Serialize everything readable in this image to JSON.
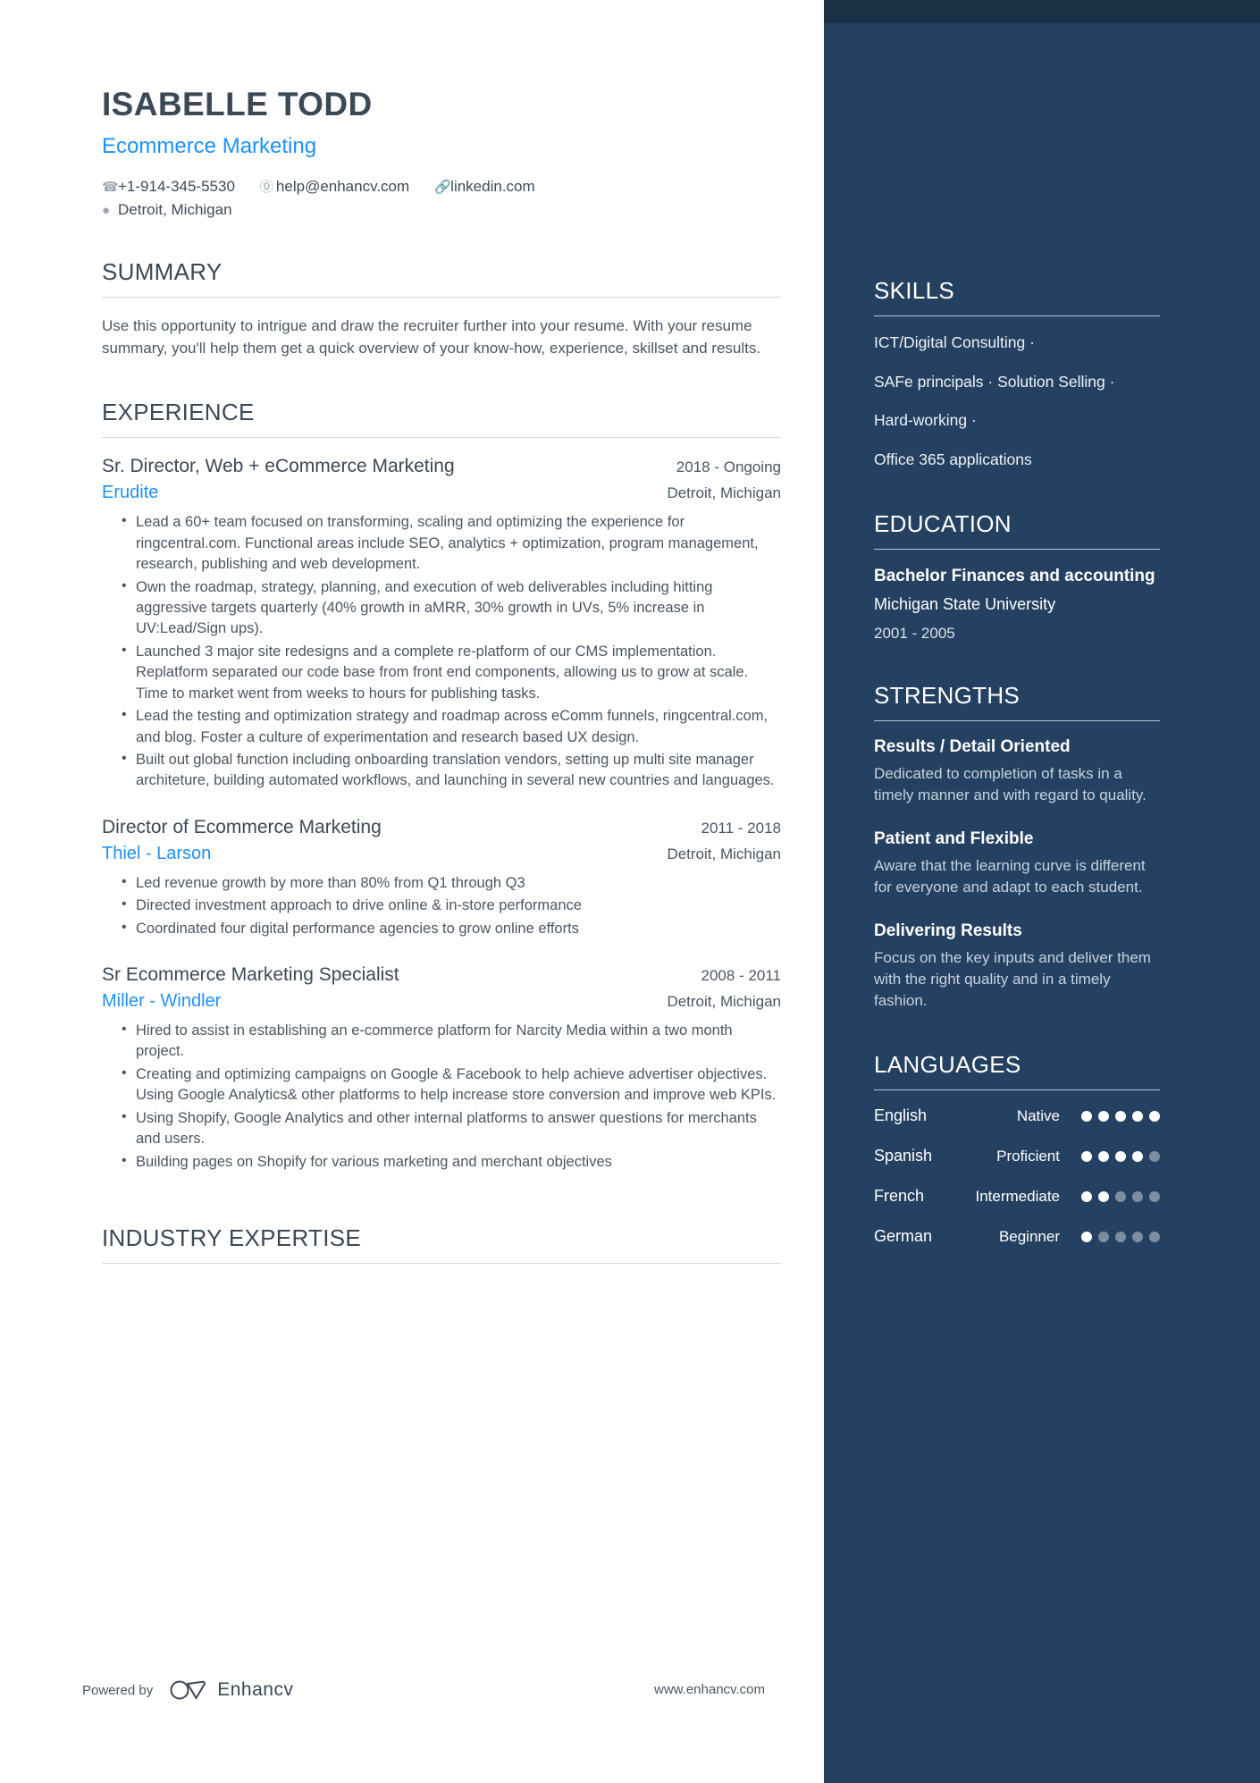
{
  "header": {
    "name": "ISABELLE TODD",
    "role": "Ecommerce Marketing",
    "contacts": {
      "phone": "+1-914-345-5530",
      "email": "help@enhancv.com",
      "linkedin": "linkedin.com",
      "location": "Detroit, Michigan"
    },
    "icons": {
      "phone": "phone-icon",
      "email": "at-sign-icon",
      "link": "link-icon",
      "location": "map-pin-icon"
    }
  },
  "sections": {
    "summary_heading": "SUMMARY",
    "experience_heading": "EXPERIENCE",
    "industry_heading": "INDUSTRY EXPERTISE",
    "skills_heading": "SKILLS",
    "education_heading": "EDUCATION",
    "strengths_heading": "STRENGTHS",
    "languages_heading": "LANGUAGES"
  },
  "summary": "Use this opportunity to intrigue and draw the recruiter further into your resume. With your resume summary, you'll help them get a quick overview of your know-how, experience, skillset and results.",
  "experience": [
    {
      "title": "Sr. Director, Web + eCommerce Marketing",
      "dates": "2018 - Ongoing",
      "company": "Erudite",
      "location": "Detroit, Michigan",
      "bullets": [
        "Lead a 60+ team focused on transforming, scaling and optimizing the experience for ringcentral.com. Functional areas include SEO, analytics + optimization, program management, research, publishing and web development.",
        "Own the roadmap, strategy, planning, and execution of web deliverables including hitting aggressive targets quarterly (40% growth in aMRR, 30% growth in UVs, 5% increase in UV:Lead/Sign ups).",
        "Launched 3 major site redesigns and a complete re-platform of our CMS implementation. Replatform separated our code base from front end components, allowing us to grow at scale. Time to market went from weeks to hours for publishing tasks.",
        "Lead the testing and optimization strategy and roadmap across eComm funnels, ringcentral.com, and blog. Foster a culture of experimentation and research based UX design.",
        "Built out global function including onboarding translation vendors, setting up multi site manager architeture, building automated workflows, and launching in several new countries and languages."
      ]
    },
    {
      "title": "Director of Ecommerce Marketing",
      "dates": "2011 - 2018",
      "company": "Thiel - Larson",
      "location": "Detroit, Michigan",
      "bullets": [
        "Led revenue growth by more than 80% from Q1 through Q3",
        "Directed investment approach to drive online & in-store performance",
        "Coordinated four digital performance agencies to grow online efforts"
      ]
    },
    {
      "title": "Sr Ecommerce Marketing Specialist",
      "dates": "2008 - 2011",
      "company": "Miller - Windler",
      "location": "Detroit, Michigan",
      "bullets": [
        "Hired to assist in establishing an e-commerce platform for Narcity Media within a two month project.",
        " Creating and optimizing campaigns on Google & Facebook to help achieve advertiser objectives. Using Google Analytics& other platforms to help increase store conversion and improve web KPIs.",
        " Using Shopify, Google Analytics and other internal platforms to answer questions for merchants and users.",
        "Building pages on Shopify for various marketing and merchant objectives"
      ]
    }
  ],
  "skills": [
    "ICT/Digital Consulting ·",
    "SAFe principals · Solution Selling ·",
    "Hard-working ·",
    "Office 365 applications"
  ],
  "education": {
    "degree": "Bachelor Finances and accounting",
    "school": "Michigan State University",
    "dates": "2001 - 2005"
  },
  "strengths": [
    {
      "title": "Results / Detail Oriented",
      "description": "Dedicated to completion of tasks in a timely manner and with regard to quality."
    },
    {
      "title": "Patient and Flexible",
      "description": "Aware that the learning curve is different for everyone and adapt to each student."
    },
    {
      "title": "Delivering Results",
      "description": "Focus on the key inputs and deliver them with the right quality and in a timely fashion."
    }
  ],
  "languages": [
    {
      "name": "English",
      "level": "Native",
      "filled": 5,
      "total": 5
    },
    {
      "name": "Spanish",
      "level": "Proficient",
      "filled": 4,
      "total": 5
    },
    {
      "name": "French",
      "level": "Intermediate",
      "filled": 2,
      "total": 5
    },
    {
      "name": "German",
      "level": "Beginner",
      "filled": 1,
      "total": 5
    }
  ],
  "footer": {
    "powered_by": "Powered by",
    "brand": "Enhancv",
    "url": "www.enhancv.com"
  },
  "colors": {
    "sidebar": "#254161",
    "sidebar_top": "#1b2f45",
    "accent": "#1e90ff",
    "heading": "#3b4856",
    "body": "#4a5663"
  }
}
